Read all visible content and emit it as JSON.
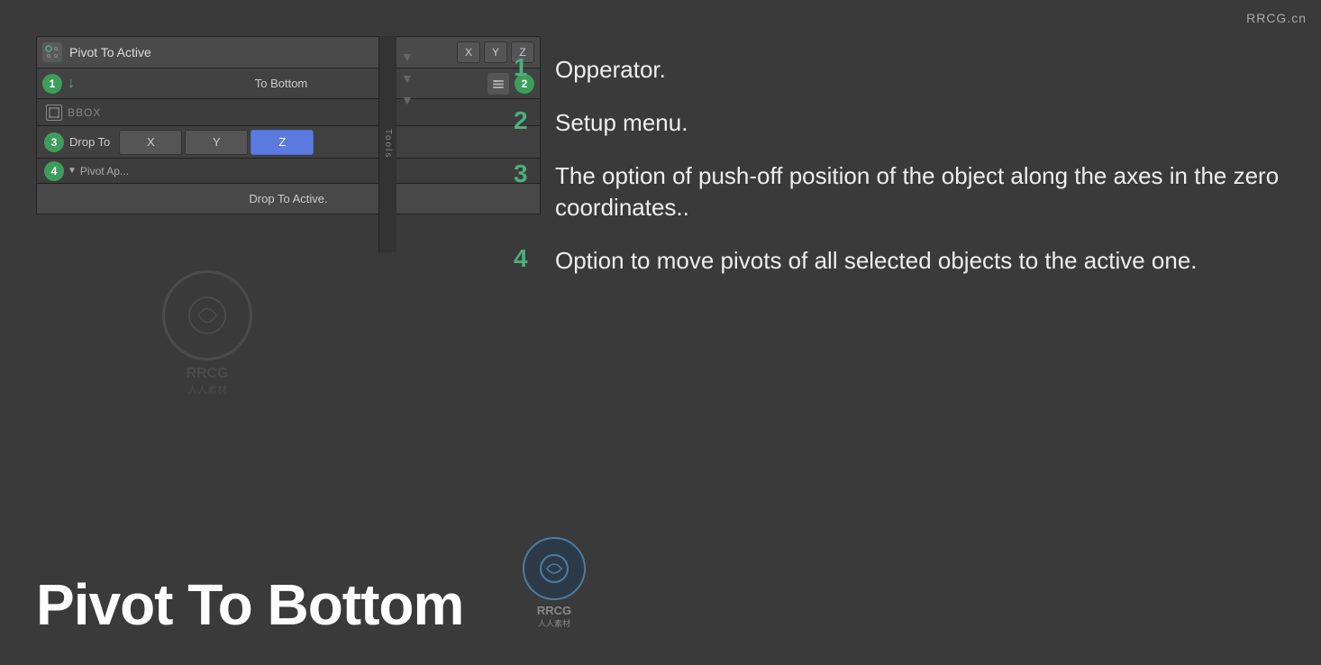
{
  "watermark": {
    "top_right": "RRCG.cn"
  },
  "ui_panel": {
    "toolbar": {
      "operator_label": "Pivot To Active",
      "x_btn": "X",
      "y_btn": "Y",
      "z_btn": "Z"
    },
    "tobottom_row": {
      "badge1": "1",
      "badge2": "2",
      "label": "To Bottom"
    },
    "bbox_label": "BBOX",
    "dropto_row": {
      "badge": "3",
      "label": "Drop To",
      "x_btn": "X",
      "y_btn": "Y",
      "z_btn": "Z"
    },
    "pivot_row": {
      "badge": "4",
      "label": "Pivot Ap..."
    },
    "dropto_active_row": {
      "label": "Drop To Active."
    }
  },
  "descriptions": [
    {
      "number": "1",
      "text": "Opperator."
    },
    {
      "number": "2",
      "text": "Setup menu."
    },
    {
      "number": "3",
      "text": "The option of push-off position of the object along the axes in the zero coordinates.."
    },
    {
      "number": "4",
      "text": "Option to move pivots of all selected objects to the active one."
    }
  ],
  "bottom_title": "Pivot To Bottom"
}
